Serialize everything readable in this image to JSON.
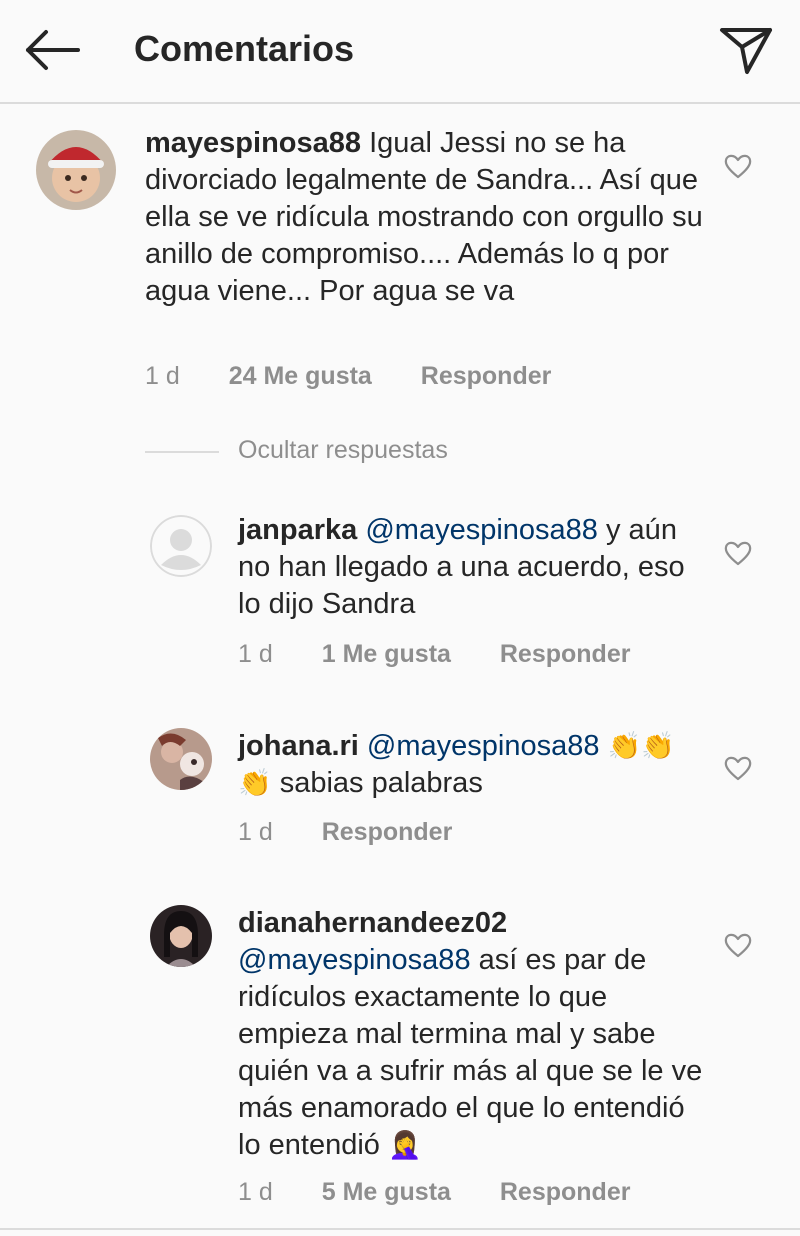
{
  "header": {
    "title": "Comentarios"
  },
  "comments": [
    {
      "username": "mayespinosa88",
      "text": "Igual Jessi no se ha divorciado legalmente de Sandra... Así que ella se ve ridícula mostrando con orgullo su anillo de compromiso.... Además lo q por agua viene... Por agua se va",
      "time": "1 d",
      "likes": "24 Me gusta",
      "reply": "Responder"
    }
  ],
  "hide_replies": "Ocultar respuestas",
  "replies": [
    {
      "username": "janparka",
      "mention": "@mayespinosa88",
      "text": "y aún no han llegado a una acuerdo, eso lo dijo Sandra",
      "time": "1 d",
      "likes": "1 Me gusta",
      "reply": "Responder"
    },
    {
      "username": "johana.ri",
      "mention": "@mayespinosa88",
      "emoji": "👏👏👏",
      "text": "sabias palabras",
      "time": "1 d",
      "reply": "Responder"
    },
    {
      "username": "dianahernandeez02",
      "mention": "@mayespinosa88",
      "text": "así es par de ridículos exactamente lo que empieza mal termina mal y sabe quién va a sufrir más al que se le ve más enamorado el que lo entendió lo entendió",
      "emoji": "🤦‍♀️",
      "time": "1 d",
      "likes": "5 Me gusta",
      "reply": "Responder"
    }
  ],
  "icons": {
    "back": "arrow-left-icon",
    "send": "paper-plane-icon",
    "like": "heart-outline-icon"
  }
}
